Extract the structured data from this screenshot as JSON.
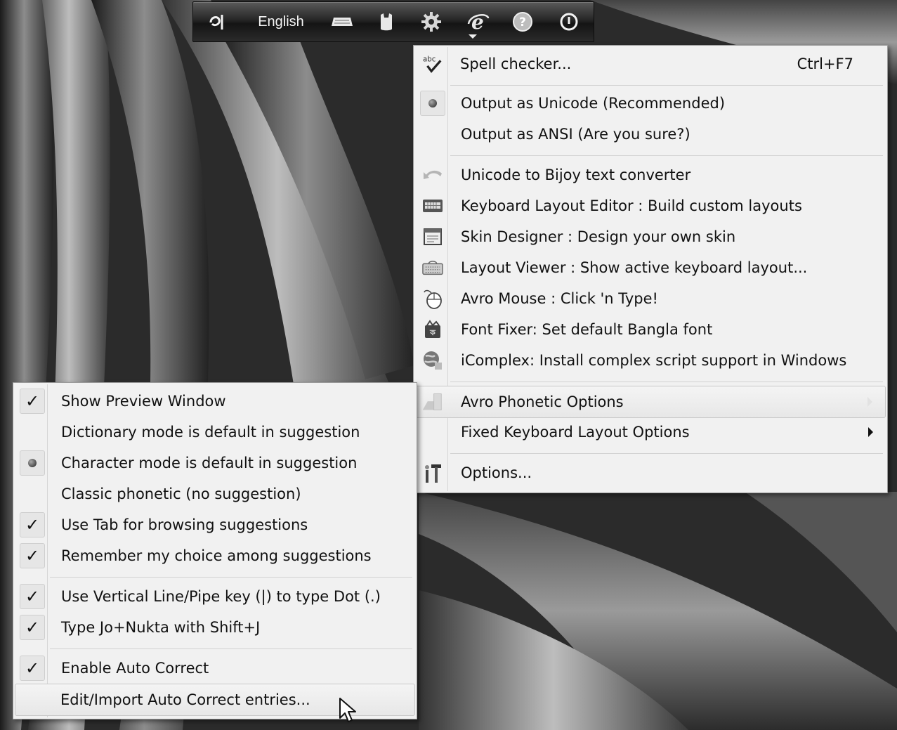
{
  "toolbar": {
    "language": "English",
    "icons": [
      "bangla-layout-icon",
      "keyboard-icon",
      "mouse-icon",
      "gear-icon",
      "internet-explorer-icon",
      "help-icon",
      "exit-icon"
    ]
  },
  "main_menu": {
    "items": [
      {
        "label": "Spell checker...",
        "accel": "Ctrl+F7",
        "icon": "spell-check-icon"
      },
      {
        "label": "Output as Unicode (Recommended)",
        "state": "selected-radio"
      },
      {
        "label": "Output as ANSI (Are you sure?)"
      },
      {
        "label": "Unicode to Bijoy text converter",
        "icon": "undo-arrow-icon"
      },
      {
        "label": "Keyboard Layout Editor : Build custom layouts",
        "icon": "keyboard-icon"
      },
      {
        "label": "Skin Designer : Design your own skin",
        "icon": "window-icon"
      },
      {
        "label": "Layout Viewer : Show active keyboard layout...",
        "icon": "keyboard-viewer-icon"
      },
      {
        "label": "Avro Mouse : Click 'n Type!",
        "icon": "mouse-icon"
      },
      {
        "label": "Font Fixer: Set default Bangla font",
        "icon": "font-fixer-icon"
      },
      {
        "label": "iComplex: Install complex script support in Windows",
        "icon": "globe-icon"
      },
      {
        "label": "Avro Phonetic Options",
        "icon": "phonetic-icon"
      },
      {
        "label": "Fixed Keyboard Layout Options"
      },
      {
        "label": "Options...",
        "icon": "tools-icon"
      }
    ]
  },
  "sub_menu": {
    "items": [
      {
        "label": "Show Preview Window",
        "state": "checked"
      },
      {
        "label": "Dictionary mode is default in suggestion"
      },
      {
        "label": "Character mode is default in suggestion",
        "state": "selected-radio"
      },
      {
        "label": "Classic phonetic (no suggestion)"
      },
      {
        "label": "Use Tab for browsing suggestions",
        "state": "checked"
      },
      {
        "label": "Remember my choice among suggestions",
        "state": "checked"
      },
      {
        "label": "Use Vertical Line/Pipe key (|) to type Dot (.)",
        "state": "checked"
      },
      {
        "label": "Type Jo+Nukta with Shift+J",
        "state": "checked"
      },
      {
        "label": "Enable Auto Correct",
        "state": "checked"
      },
      {
        "label": "Edit/Import Auto Correct entries...",
        "state": "hovered"
      }
    ]
  },
  "check_glyph": "✓"
}
